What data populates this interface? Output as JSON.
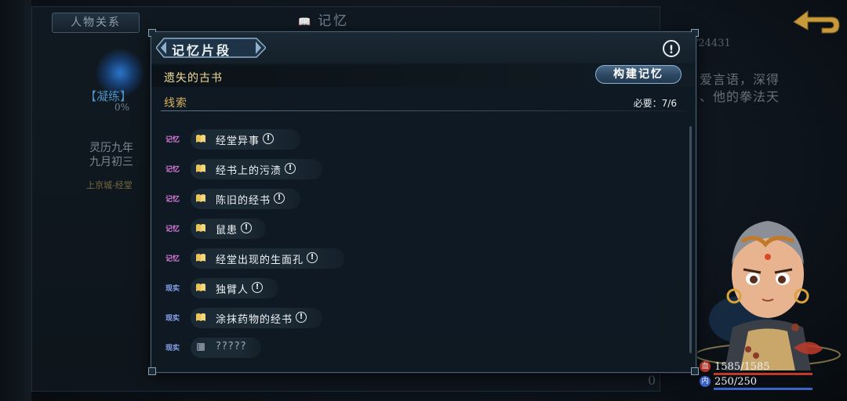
{
  "background": {
    "relations_tab": "人物关系",
    "header_title": "记忆",
    "orb_label": "【凝练】",
    "orb_percent": "0%",
    "date_line1": "灵历九年",
    "date_line2": "九月初三",
    "location": "上京城-经堂",
    "score_text": "/24431",
    "story_line1": "爱言语，深得",
    "story_line2": "、他的拳法天",
    "bottom_number": "0"
  },
  "dialog": {
    "title": "记忆片段",
    "info_icon": "!",
    "subject": "遗失的古书",
    "build_button": "构建记忆",
    "clue_label": "线索",
    "required_label": "必要：7/6",
    "clues": [
      {
        "tag": "记忆",
        "kind": "memory",
        "text": "经堂异事",
        "alert": "!"
      },
      {
        "tag": "记忆",
        "kind": "memory",
        "text": "经书上的污渍",
        "alert": "!"
      },
      {
        "tag": "记忆",
        "kind": "memory",
        "text": "陈旧的经书",
        "alert": "!"
      },
      {
        "tag": "记忆",
        "kind": "memory",
        "text": "鼠患",
        "alert": "!"
      },
      {
        "tag": "记忆",
        "kind": "memory",
        "text": "经堂出现的生面孔",
        "alert": "!"
      },
      {
        "tag": "现实",
        "kind": "reality",
        "text": "独臂人",
        "alert": "!"
      },
      {
        "tag": "现实",
        "kind": "reality",
        "text": "涂抹药物的经书",
        "alert": "!"
      },
      {
        "tag": "现实",
        "kind": "reality",
        "text": "?????",
        "alert": ""
      }
    ]
  },
  "character": {
    "hp_icon": "血",
    "hp": "1585/1585",
    "mp_icon": "内",
    "mp": "250/250"
  },
  "colors": {
    "memory_tag": "#d67ad7",
    "reality_tag": "#8aa6f3",
    "subject_gold": "#eedb9a",
    "clue_label_gold": "#d9b35c",
    "hp_red": "#c0392b",
    "mp_blue": "#3a62c8"
  }
}
